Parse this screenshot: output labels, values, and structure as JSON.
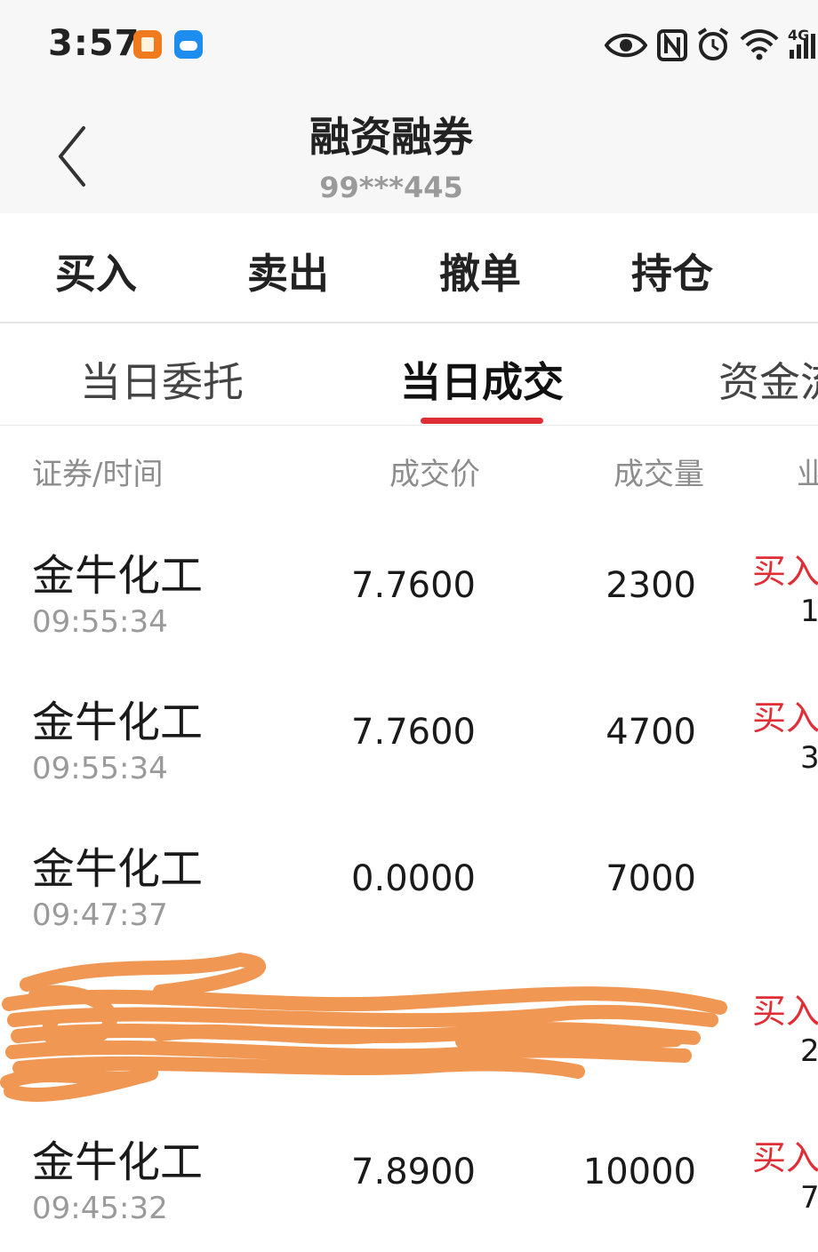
{
  "status_bar": {
    "time": "3:57",
    "icons": [
      "app-notification-icon",
      "weather-icon",
      "eye-icon",
      "nfc-icon",
      "alarm-icon",
      "wifi-icon",
      "4g-signal-icon"
    ],
    "network_label": "4G"
  },
  "header": {
    "title": "融资融券",
    "account": "99***445",
    "back_icon": "chevron-left-icon"
  },
  "action_tabs": [
    {
      "label": "买入"
    },
    {
      "label": "卖出"
    },
    {
      "label": "撤单"
    },
    {
      "label": "持仓"
    }
  ],
  "sub_tabs": [
    {
      "label": "当日委托",
      "active": false
    },
    {
      "label": "当日成交",
      "active": true
    },
    {
      "label": "资金流",
      "active": false
    }
  ],
  "table": {
    "columns": [
      "证券/时间",
      "成交价",
      "成交量",
      "业"
    ],
    "rows": [
      {
        "name": "金牛化工",
        "time": "09:55:34",
        "price": "7.7600",
        "qty": "2300",
        "type": "买入",
        "extra": "1"
      },
      {
        "name": "金牛化工",
        "time": "09:55:34",
        "price": "7.7600",
        "qty": "4700",
        "type": "买入",
        "extra": "3"
      },
      {
        "name": "金牛化工",
        "time": "09:47:37",
        "price": "0.0000",
        "qty": "7000",
        "type": "",
        "extra": ""
      },
      {
        "name": "",
        "time": "",
        "price": "",
        "qty": "",
        "type": "买入",
        "extra": "2",
        "redacted": true
      },
      {
        "name": "金牛化工",
        "time": "09:45:32",
        "price": "7.8900",
        "qty": "10000",
        "type": "买入",
        "extra": "7"
      }
    ]
  },
  "colors": {
    "accent_red": "#e02e36",
    "redaction": "#f0924a",
    "header_bg": "#f7f7f7"
  }
}
